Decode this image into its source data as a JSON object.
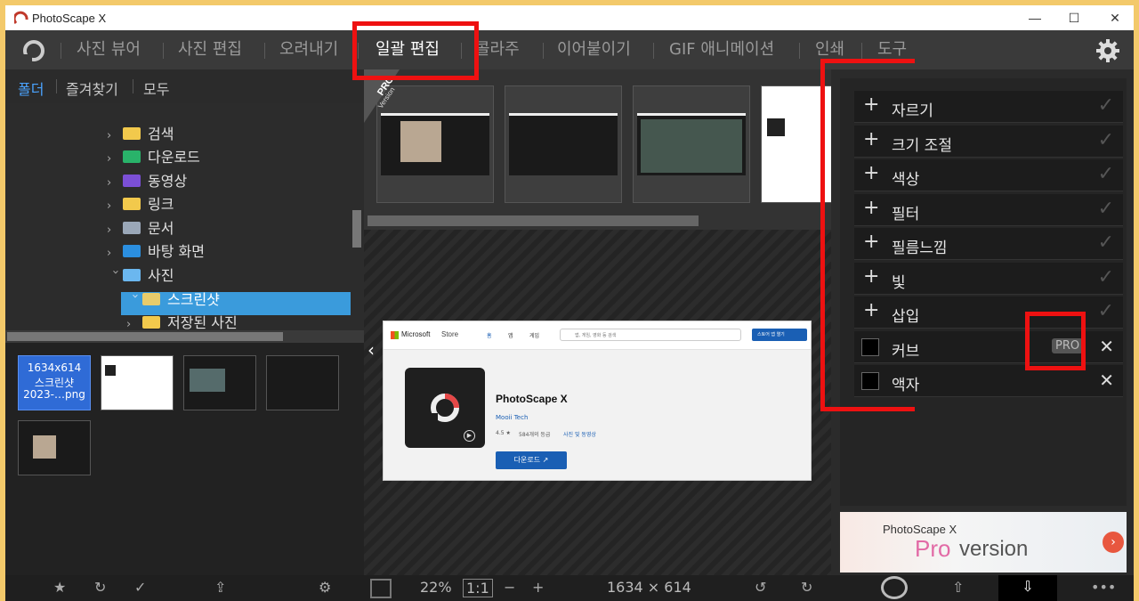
{
  "window": {
    "title": "PhotoScape X",
    "minimize": "—",
    "maximize": "☐",
    "close": "✕"
  },
  "menu": {
    "items": [
      "사진 뷰어",
      "사진 편집",
      "오려내기",
      "일괄 편집",
      "콜라주",
      "이어붙이기",
      "GIF 애니메이션",
      "인쇄",
      "도구"
    ],
    "active": "일괄 편집",
    "settings_icon": "gear-icon"
  },
  "left_tabs": [
    "폴더",
    "즐겨찾기",
    "모두"
  ],
  "folders": [
    {
      "label": "검색",
      "color": "#f2c94c",
      "expanded": false
    },
    {
      "label": "다운로드",
      "color": "#29b36a",
      "expanded": false
    },
    {
      "label": "동영상",
      "color": "#7b4fd6",
      "expanded": false
    },
    {
      "label": "링크",
      "color": "#f2c94c",
      "expanded": false
    },
    {
      "label": "문서",
      "color": "#9aa7b8",
      "expanded": false
    },
    {
      "label": "바탕 화면",
      "color": "#2b8fe0",
      "expanded": false
    },
    {
      "label": "사진",
      "color": "#6bb7ef",
      "expanded": true
    },
    {
      "label": "스크린샷",
      "color": "#e8cc6b",
      "selected": true
    },
    {
      "label": "저장된 사진",
      "color": "#f2c94c",
      "expanded": false
    }
  ],
  "file_thumbs": [
    {
      "size": "1634x614",
      "name": "스크린샷",
      "date": "2023-…png"
    }
  ],
  "preview": {
    "store_logo": "Microsoft",
    "store_name": "Store",
    "nav": [
      "홈",
      "앱",
      "게임"
    ],
    "search_placeholder": "앱, 게임, 영화 등 검색",
    "open_btn": "스토어 앱 열기",
    "app_name": "PhotoScape X",
    "publisher": "Mooii Tech",
    "rating": "4.5 ★",
    "ratings_count": "584개의 등급",
    "category": "사진 및 동영상",
    "download_btn": "다운로드 ↗"
  },
  "effects": [
    {
      "label": "자르기",
      "type": "plus"
    },
    {
      "label": "크기 조절",
      "type": "plus"
    },
    {
      "label": "색상",
      "type": "plus"
    },
    {
      "label": "필터",
      "type": "plus"
    },
    {
      "label": "필름느낌",
      "type": "plus"
    },
    {
      "label": "빛",
      "type": "plus"
    },
    {
      "label": "삽입",
      "type": "plus"
    },
    {
      "label": "커브",
      "type": "checkbox",
      "badge": "PRO"
    },
    {
      "label": "액자",
      "type": "checkbox"
    }
  ],
  "pro_banner": {
    "corner": "PRO",
    "corner_sub": "Version"
  },
  "ad": {
    "title": "PhotoScape X",
    "pro": "Pro",
    "version": "version"
  },
  "bottom": {
    "zoom": "22%",
    "ratio": "1:1",
    "minus": "−",
    "plus": "+",
    "dimensions": "1634 × 614",
    "more": "•••"
  }
}
